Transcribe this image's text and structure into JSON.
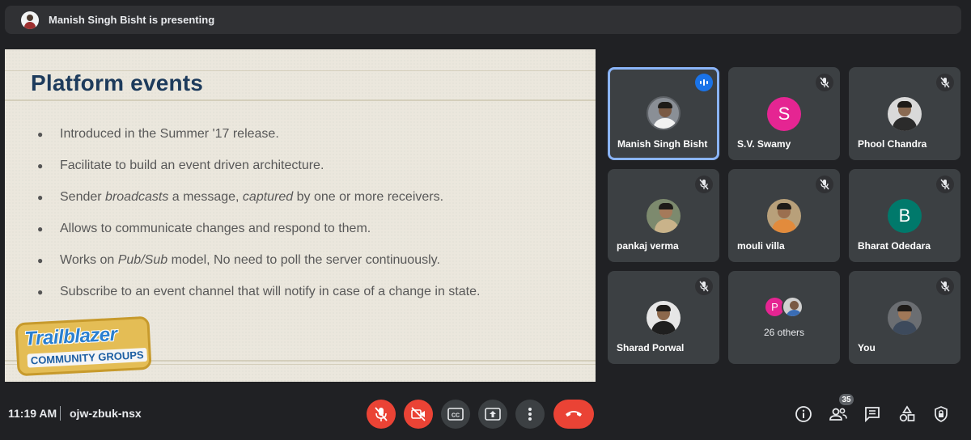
{
  "banner": {
    "presenter_text": "Manish Singh Bisht is presenting"
  },
  "slide": {
    "title": "Platform events",
    "bullets": [
      {
        "pre": "Introduced in the Summer '17 release.",
        "em1": "",
        "mid": "",
        "em2": "",
        "post": ""
      },
      {
        "pre": "Facilitate to build an event driven architecture.",
        "em1": "",
        "mid": "",
        "em2": "",
        "post": ""
      },
      {
        "pre": "Sender ",
        "em1": "broadcasts",
        "mid": " a message, ",
        "em2": "captured",
        "post": " by one or more receivers."
      },
      {
        "pre": "Allows to communicate changes and respond to them.",
        "em1": "",
        "mid": "",
        "em2": "",
        "post": ""
      },
      {
        "pre": "Works on ",
        "em1": "Pub/Sub",
        "mid": " model, No need to poll the server continuously.",
        "em2": "",
        "post": ""
      },
      {
        "pre": "Subscribe to an event channel that will notify in case of a change in state.",
        "em1": "",
        "mid": "",
        "em2": "",
        "post": ""
      }
    ],
    "logo_line1": "Trailblazer",
    "logo_line2": "COMMUNITY GROUPS"
  },
  "participants": [
    {
      "name": "Manish Singh Bisht",
      "initial": "",
      "color": "",
      "speaking": true
    },
    {
      "name": "S.V. Swamy",
      "initial": "S",
      "color": "#e52592",
      "speaking": false
    },
    {
      "name": "Phool Chandra",
      "initial": "",
      "color": "",
      "speaking": false
    },
    {
      "name": "pankaj verma",
      "initial": "",
      "color": "",
      "speaking": false
    },
    {
      "name": "mouli villa",
      "initial": "",
      "color": "",
      "speaking": false
    },
    {
      "name": "Bharat Odedara",
      "initial": "B",
      "color": "#00796b",
      "speaking": false
    },
    {
      "name": "Sharad Porwal",
      "initial": "",
      "color": "",
      "speaking": false
    },
    {
      "name": "You",
      "initial": "",
      "color": "",
      "speaking": false
    }
  ],
  "others": {
    "initial": "P",
    "label": "26 others"
  },
  "bottom_bar": {
    "time": "11:19 AM",
    "meeting_code": "ojw-zbuk-nsx",
    "people_count": "35"
  },
  "colors": {
    "accent_blue": "#8ab4f8",
    "danger_red": "#ea4335",
    "tile_bg": "#3c4043",
    "page_bg": "#202124"
  }
}
